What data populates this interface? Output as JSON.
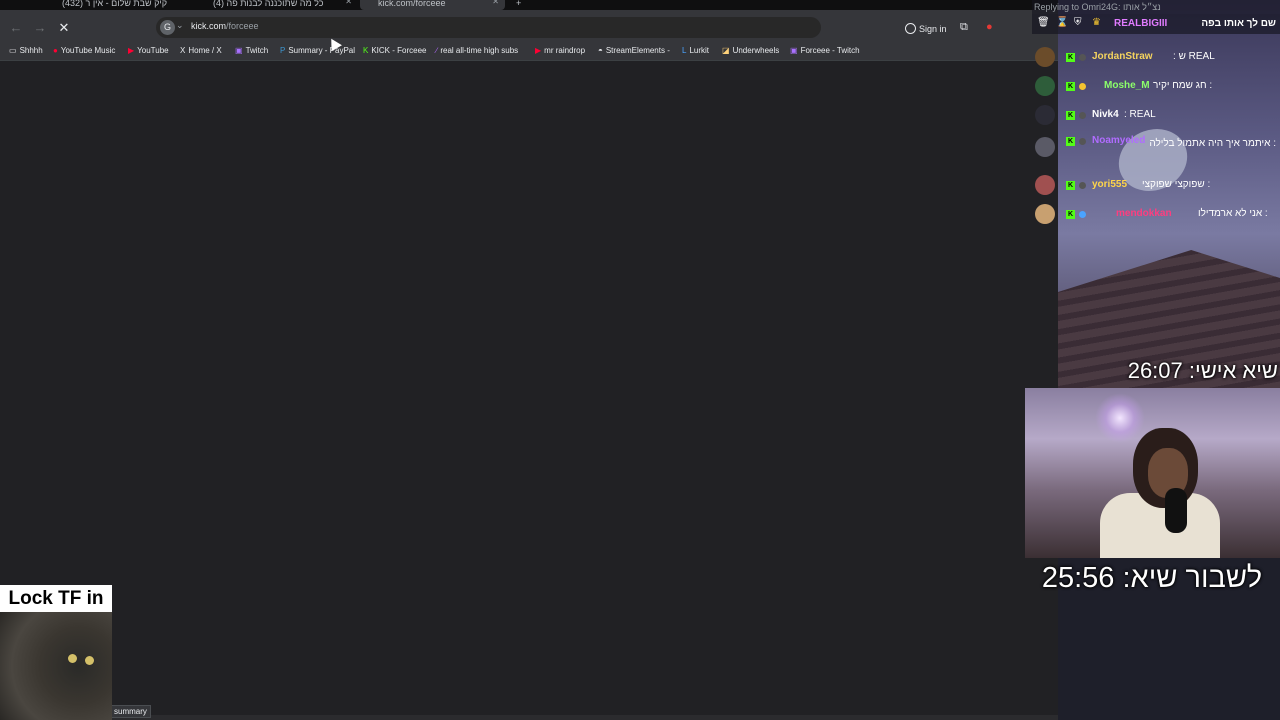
{
  "browser": {
    "tabs": [
      {
        "label": "(432) קיק שבת שלום - אין ר",
        "active": false
      },
      {
        "label": "(4) כל מה שתוכננה לבנות פה",
        "active": false
      },
      {
        "label": "kick.com/forceee",
        "active": true
      }
    ],
    "new_tab_label": "+",
    "url_host": "kick.com",
    "url_path": "/forceee",
    "signin_label": "Sign in",
    "status_tooltip": "summary"
  },
  "bookmarks": [
    {
      "label": "Shhhh",
      "icon": "folder-icon"
    },
    {
      "label": "YouTube Music",
      "icon": "youtube-music-icon"
    },
    {
      "label": "YouTube",
      "icon": "youtube-icon"
    },
    {
      "label": "Home / X",
      "icon": "x-icon"
    },
    {
      "label": "Twitch",
      "icon": "twitch-icon"
    },
    {
      "label": "Summary - PayPal",
      "icon": "paypal-icon"
    },
    {
      "label": "KICK - Forceee",
      "icon": "kick-icon"
    },
    {
      "label": "real all-time high subs",
      "icon": "feather-icon"
    },
    {
      "label": "mr raindrop",
      "icon": "youtube-icon"
    },
    {
      "label": "StreamElements -",
      "icon": "streamelements-icon"
    },
    {
      "label": "Lurkit",
      "icon": "lurkit-icon"
    },
    {
      "label": "Underwheels",
      "icon": "underwheels-icon"
    },
    {
      "label": "Forceee - Twitch",
      "icon": "twitch-icon"
    }
  ],
  "overlay": {
    "lock_label": "Lock TF in",
    "timer_personal": "שיא אישי: 26:07",
    "timer_break": "לשבור שיא: 25:56"
  },
  "chat": {
    "replying_to": "Replying to Omri24G: נצ״ל אותו",
    "pinned": {
      "name": "REALBIGIII",
      "message": "שם לך אותו בפה"
    },
    "messages": [
      {
        "name": "JordanStraw",
        "name_color": "#f4d35e",
        "text": ": ש REAL",
        "avatar_color": "#6b4c2a"
      },
      {
        "name": "Moshe_M",
        "name_color": "#8cff6a",
        "text": ": חג שמח יקיר",
        "avatar_color": "#2e5d3a"
      },
      {
        "name": "Nivk4",
        "name_color": "#ffffff",
        "text": ": REAL",
        "avatar_color": "#2b2b35"
      },
      {
        "name": "Noamyeled",
        "name_color": "#b06cff",
        "text": ": איתמר איך היה אתמול בלילה",
        "avatar_color": "#5a5a66"
      },
      {
        "name": "yori555",
        "name_color": "#ffd54a",
        "text": ": שפוקצי שפוקצי",
        "avatar_color": "#a05050"
      },
      {
        "name": "mendokkan",
        "name_color": "#ff3d7f",
        "text": ": אני לא ארמדילו",
        "avatar_color": "#c8a070"
      }
    ]
  }
}
